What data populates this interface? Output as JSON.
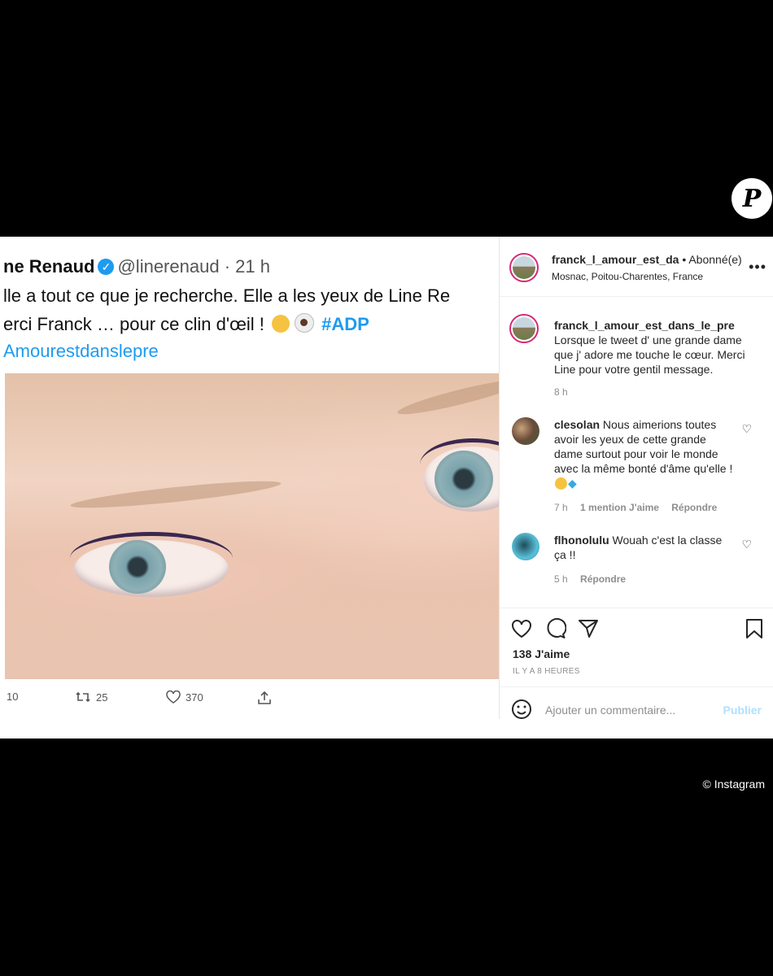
{
  "watermark": {
    "logo_letter": "P",
    "credit": "© Instagram"
  },
  "tweet": {
    "name": "ne Renaud",
    "handle": "@linerenaud",
    "time": "· 21 h",
    "line1": "lle a tout ce que je recherche. Elle a les yeux de Line Re",
    "line2_text": "erci Franck … pour ce clin d'œil !",
    "line2_hashtag": "#ADP",
    "line3": "Amourestdanslepre",
    "replies": "10",
    "retweets": "25",
    "likes": "370"
  },
  "post": {
    "header": {
      "username": "franck_l_amour_est_da",
      "follow_status": "• Abonné(e)",
      "location": "Mosnac, Poitou-Charentes, France"
    },
    "caption": {
      "username": "franck_l_amour_est_dans_le_pre",
      "text": "Lorsque le tweet d' une grande dame que j' adore me touche le cœur. Merci Line pour votre gentil message.",
      "time": "8 h"
    },
    "comments": [
      {
        "username": "clesolan",
        "text": "Nous aimerions toutes avoir les yeux de cette grande dame surtout pour voir le monde avec la même bonté d'âme qu'elle !",
        "time": "7 h",
        "mention": "1 mention J'aime",
        "reply": "Répondre"
      },
      {
        "username": "flhonolulu",
        "text": "Wouah c'est la classe ça !!",
        "time": "5 h",
        "reply": "Répondre"
      }
    ],
    "likes_count": "138 J'aime",
    "time_ago": "IL Y A 8 HEURES",
    "comment_placeholder": "Ajouter un commentaire...",
    "publish_label": "Publier"
  },
  "colors": {
    "accent": "#0095f6",
    "publish_disabled": "#b2dffc",
    "twitter_blue": "#1d9bf0",
    "story_ring": "#d62976"
  }
}
